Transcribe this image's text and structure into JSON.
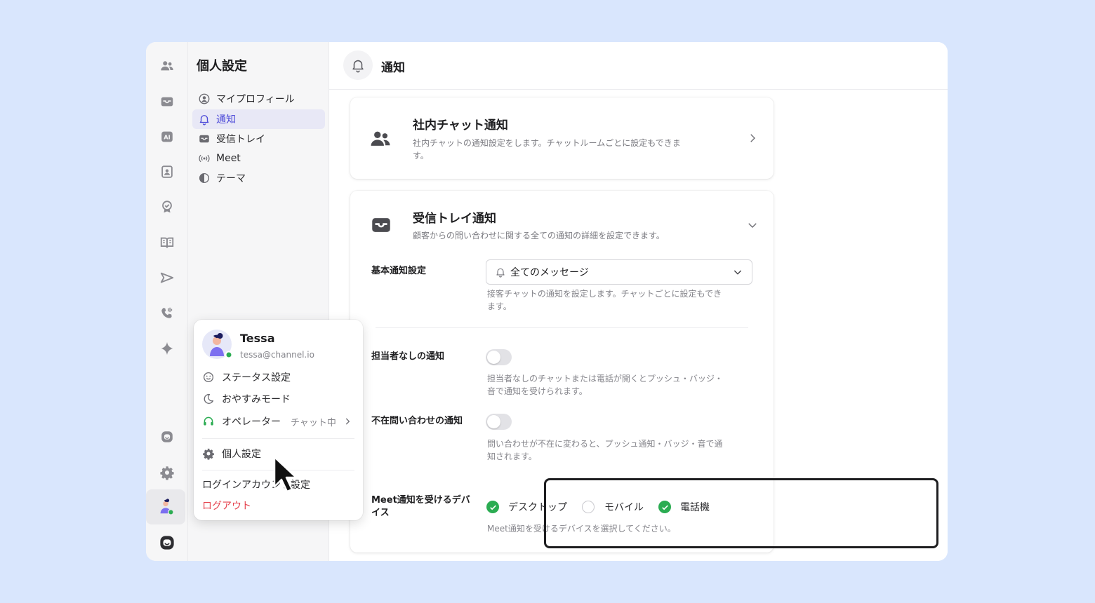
{
  "rail": {
    "icons": [
      "team-chat-icon",
      "inbox-icon",
      "ai-icon",
      "contacts-icon",
      "tasks-icon",
      "docs-icon",
      "campaign-icon",
      "phone-icon",
      "sparkle-icon",
      "channel-icon",
      "settings-icon",
      "avatar",
      "channel-logo-icon"
    ],
    "ai_label": "AI"
  },
  "sidebar": {
    "title": "個人設定",
    "items": [
      {
        "label": "マイプロフィール",
        "icon": "profile-icon"
      },
      {
        "label": "通知",
        "icon": "bell-icon",
        "active": true
      },
      {
        "label": "受信トレイ",
        "icon": "inbox-icon"
      },
      {
        "label": "Meet",
        "icon": "broadcast-icon"
      },
      {
        "label": "テーマ",
        "icon": "theme-icon"
      }
    ]
  },
  "header": {
    "title": "通知"
  },
  "team_chat_card": {
    "title": "社内チャット通知",
    "desc_line1": "社内チャットの通知設定をします。チャットルームごとに設定もできま",
    "desc_line2": "す。"
  },
  "inbox_card": {
    "title": "受信トレイ通知",
    "desc": "顧客からの問い合わせに関する全ての通知の詳細を設定できます。",
    "basic": {
      "label": "基本通知設定",
      "select_value": "全てのメッセージ",
      "help_line1": "接客チャットの通知を設定します。チャットごとに設定もでき",
      "help_line2": "ます。"
    },
    "unassigned": {
      "label": "担当者なしの通知",
      "enabled": false,
      "help_line1": "担当者なしのチャットまたは電話が開くとプッシュ・バッジ・",
      "help_line2": "音で通知を受けられます。"
    },
    "away": {
      "label": "不在問い合わせの通知",
      "enabled": false,
      "help_line1": "問い合わせが不在に変わると、プッシュ通知・バッジ・音で通",
      "help_line2": "知されます。"
    },
    "meet": {
      "label_line1": "Meet通知を受けるデバ",
      "label_line2": "イス",
      "devices": [
        {
          "label": "デスクトップ",
          "checked": true
        },
        {
          "label": "モバイル",
          "checked": false
        },
        {
          "label": "電話機",
          "checked": true
        }
      ],
      "help": "Meet通知を受けるデバイスを選択してください。"
    }
  },
  "popup": {
    "name": "Tessa",
    "email": "tessa@channel.io",
    "items": {
      "status": "ステータス設定",
      "dnd": "おやすみモード",
      "operator": "オペレーター",
      "operator_status": "チャット中",
      "personal": "個人設定",
      "login": "ログインアカウント設定",
      "logout": "ログアウト"
    }
  },
  "colors": {
    "background": "#d9e6fd",
    "accent": "#4a47d8",
    "green": "#2bac52",
    "logout_red": "#e5424d"
  }
}
